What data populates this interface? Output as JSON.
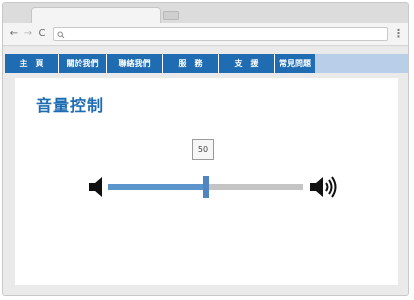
{
  "browser": {
    "menu_icon": "⋮",
    "back_icon": "←",
    "forward_icon": "→",
    "reload_icon": "C",
    "search_icon": "🔍"
  },
  "nav": {
    "items": [
      {
        "label": "主　頁"
      },
      {
        "label": "關於我們"
      },
      {
        "label": "聯絡我們"
      },
      {
        "label": "服　務"
      },
      {
        "label": "支　援"
      },
      {
        "label": "常見問題"
      }
    ]
  },
  "page": {
    "title": "音量控制"
  },
  "volume": {
    "value": 50,
    "value_label": "50",
    "min": 0,
    "max": 100,
    "mute_icon": "speaker-mute-icon",
    "loud_icon": "speaker-loud-icon"
  },
  "colors": {
    "accent": "#1f6cb3",
    "slider_fill": "#5b95cc",
    "slider_track": "#c4c4c4"
  }
}
